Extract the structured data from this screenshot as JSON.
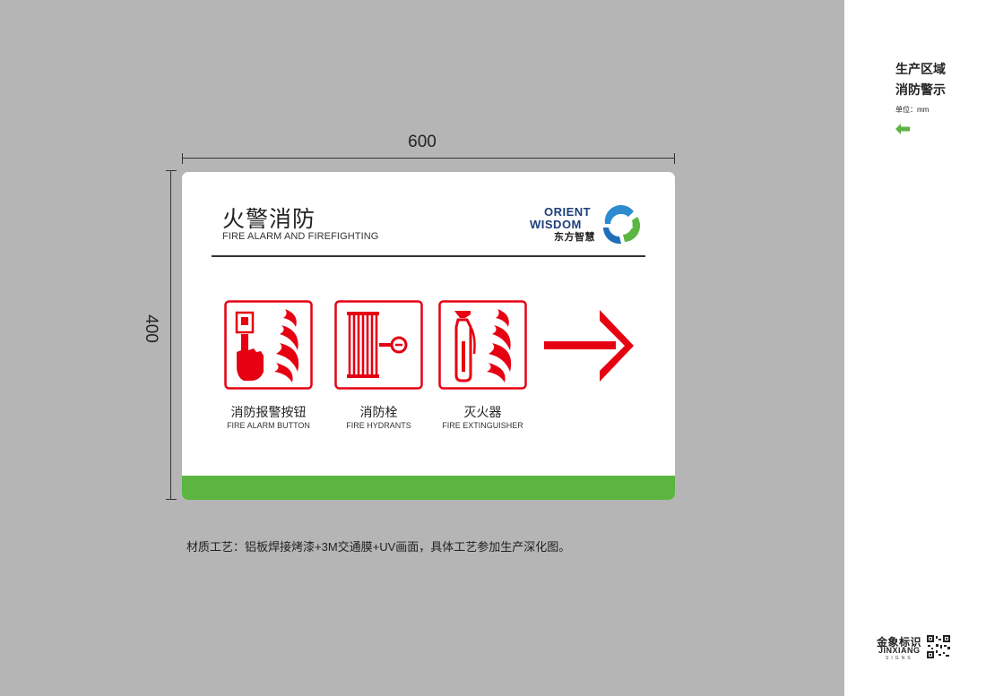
{
  "dimensions": {
    "width": "600",
    "height": "400"
  },
  "sign": {
    "title": "火警消防",
    "subtitle": "FIRE ALARM AND FIREFIGHTING",
    "logo": {
      "line1": "ORIENT",
      "line2": "WISDOM",
      "line3": "东方智慧"
    },
    "items": [
      {
        "label_cn": "消防报警按钮",
        "label_en": "FIRE ALARM BUTTON",
        "icon": "fire-alarm-button-icon"
      },
      {
        "label_cn": "消防栓",
        "label_en": "FIRE HYDRANTS",
        "icon": "fire-hose-reel-icon"
      },
      {
        "label_cn": "灭火器",
        "label_en": "FIRE EXTINGUISHER",
        "icon": "fire-extinguisher-icon"
      }
    ],
    "arrow": "right-arrow-icon",
    "colors": {
      "icon_red": "#e60012",
      "bar_green": "#5bb540",
      "logo_blue": "#1e3f7a"
    }
  },
  "material_note": "材质工艺：铝板焊接烤漆+3M交通膜+UV画面，具体工艺参加生产深化图。",
  "side_panel": {
    "title_line1": "生产区域",
    "title_line2": "消防警示",
    "unit": "单位：mm",
    "brand_cn": "金象标识",
    "brand_en": "JINXIANG",
    "brand_sub": "SIGNS"
  }
}
